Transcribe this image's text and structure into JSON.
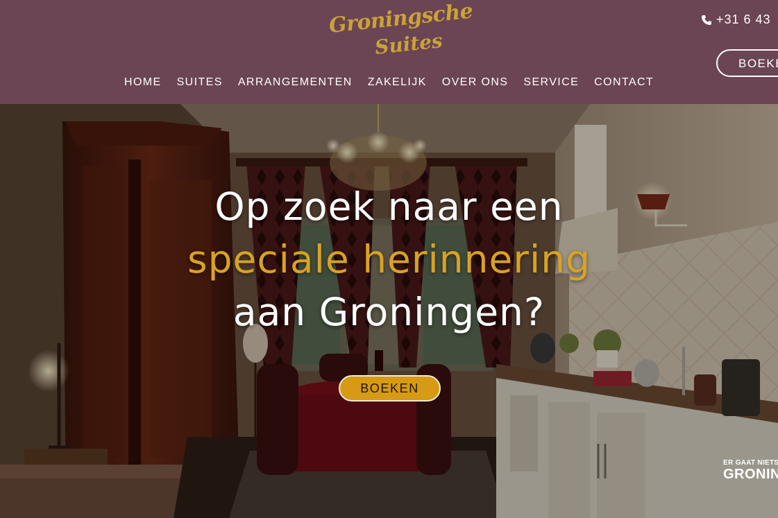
{
  "header": {
    "logo": {
      "line1": "Groningsche",
      "line2": "Suites"
    },
    "phone": "+31 6 43",
    "book_button": "BOEKEN",
    "nav": [
      "HOME",
      "SUITES",
      "ARRANGEMENTEN",
      "ZAKELIJK",
      "OVER ONS",
      "SERVICE",
      "CONTACT"
    ]
  },
  "hero": {
    "headline_line1": "Op zoek naar een",
    "headline_line2": "speciale herinnering",
    "headline_line3": "aan Groningen?",
    "cta_label": "BOEKEN",
    "badge_line1": "ER GAAT NIETS",
    "badge_line2": "GRONIN"
  },
  "colors": {
    "header_bg": "#6b4553",
    "logo": "#c9a23a",
    "highlight": "#d9a222",
    "cta_bg": "#d69a14"
  },
  "icons": {
    "phone": "phone-icon"
  }
}
